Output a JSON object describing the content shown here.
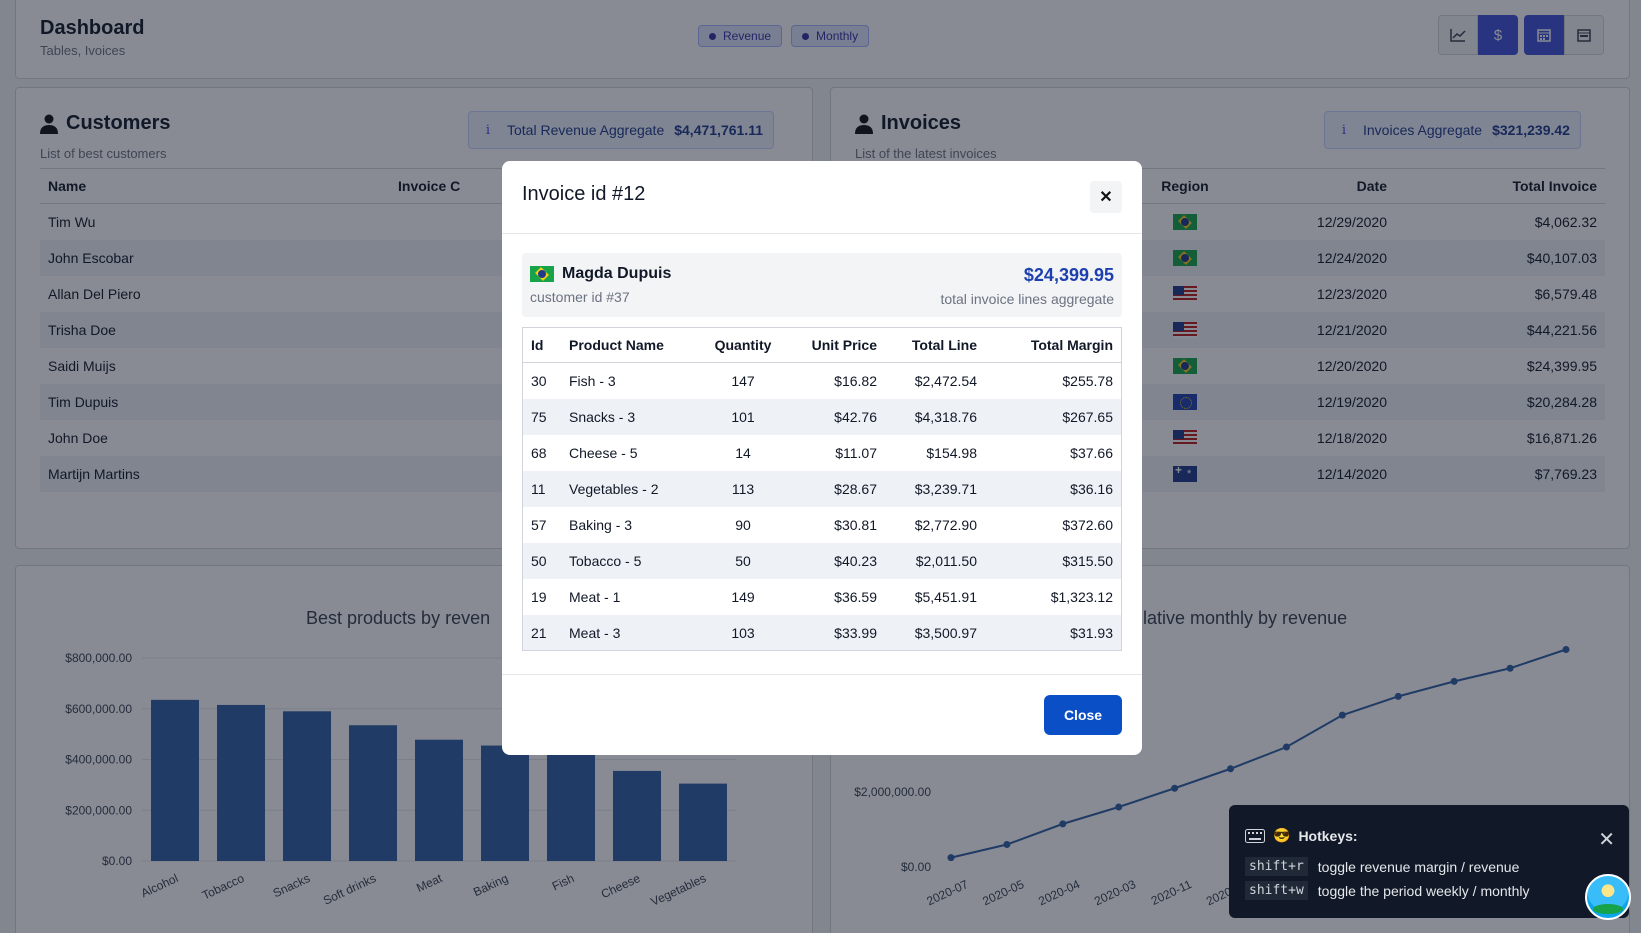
{
  "header": {
    "title": "Dashboard",
    "subtitle": "Tables, Ivoices",
    "pills": [
      "Revenue",
      "Monthly"
    ],
    "toolbar_icons": [
      "line-chart-icon",
      "dollar-icon",
      "calendar-month-icon",
      "calendar-week-icon"
    ]
  },
  "customers": {
    "title": "Customers",
    "subtitle": "List of best customers",
    "aggregate_label": "Total Revenue Aggregate",
    "aggregate_value": "$4,471,761.11",
    "columns": [
      "Name",
      "Invoice C"
    ],
    "rows": [
      "Tim Wu",
      "John Escobar",
      "Allan Del Piero",
      "Trisha Doe",
      "Saidi Muijs",
      "Tim Dupuis",
      "John Doe",
      "Martijn Martins"
    ]
  },
  "invoices": {
    "title": "Invoices",
    "subtitle": "List of the latest invoices",
    "aggregate_label": "Invoices Aggregate",
    "aggregate_value": "$321,239.42",
    "columns": [
      "Region",
      "Date",
      "Total Invoice"
    ],
    "rows": [
      {
        "region": "br",
        "date": "12/29/2020",
        "total": "$4,062.32"
      },
      {
        "region": "br",
        "date": "12/24/2020",
        "total": "$40,107.03"
      },
      {
        "region": "us",
        "date": "12/23/2020",
        "total": "$6,579.48"
      },
      {
        "region": "us",
        "date": "12/21/2020",
        "total": "$44,221.56"
      },
      {
        "region": "br",
        "date": "12/20/2020",
        "total": "$24,399.95"
      },
      {
        "region": "eu",
        "date": "12/19/2020",
        "total": "$20,284.28"
      },
      {
        "region": "us",
        "date": "12/18/2020",
        "total": "$16,871.26"
      },
      {
        "region": "au",
        "date": "12/14/2020",
        "total": "$7,769.23"
      }
    ]
  },
  "chart_data": [
    {
      "type": "bar",
      "title": "Best products by reven",
      "categories": [
        "Alcohol",
        "Tobacco",
        "Snacks",
        "Soft drinks",
        "Meat",
        "Baking",
        "Fish",
        "Cheese",
        "Vegetables"
      ],
      "values": [
        635000,
        615000,
        590000,
        535000,
        478000,
        455000,
        420000,
        355000,
        305000
      ],
      "ylim": [
        0,
        800000
      ],
      "yticks": [
        "$0.00",
        "$200,000.00",
        "$400,000.00",
        "$600,000.00",
        "$800,000.00"
      ],
      "color": "#2f5fa3"
    },
    {
      "type": "line",
      "title": "lative monthly by revenue",
      "x": [
        "2020-07",
        "2020-05",
        "2020-04",
        "2020-03",
        "2020-11",
        "2020-12",
        "",
        "",
        "",
        "",
        "",
        ""
      ],
      "values": [
        0.25,
        0.6,
        1.15,
        1.6,
        2.1,
        2.62,
        3.2,
        4.05,
        4.55,
        4.95,
        5.3,
        5.8
      ],
      "unit": "millions",
      "yticks": [
        "$0.00",
        "$2,000,000.00"
      ],
      "color": "#2f5fa3"
    }
  ],
  "modal": {
    "title": "Invoice id #12",
    "customer_name": "Magda Dupuis",
    "customer_id": "customer id #37",
    "amount": "$24,399.95",
    "amount_label": "total invoice lines aggregate",
    "columns": [
      "Id",
      "Product Name",
      "Quantity",
      "Unit Price",
      "Total Line",
      "Total Margin"
    ],
    "lines": [
      {
        "id": "30",
        "product": "Fish - 3",
        "qty": "147",
        "price": "$16.82",
        "total": "$2,472.54",
        "margin": "$255.78"
      },
      {
        "id": "75",
        "product": "Snacks - 3",
        "qty": "101",
        "price": "$42.76",
        "total": "$4,318.76",
        "margin": "$267.65"
      },
      {
        "id": "68",
        "product": "Cheese - 5",
        "qty": "14",
        "price": "$11.07",
        "total": "$154.98",
        "margin": "$37.66"
      },
      {
        "id": "11",
        "product": "Vegetables - 2",
        "qty": "113",
        "price": "$28.67",
        "total": "$3,239.71",
        "margin": "$36.16"
      },
      {
        "id": "57",
        "product": "Baking - 3",
        "qty": "90",
        "price": "$30.81",
        "total": "$2,772.90",
        "margin": "$372.60"
      },
      {
        "id": "50",
        "product": "Tobacco - 5",
        "qty": "50",
        "price": "$40.23",
        "total": "$2,011.50",
        "margin": "$315.50"
      },
      {
        "id": "19",
        "product": "Meat - 1",
        "qty": "149",
        "price": "$36.59",
        "total": "$5,451.91",
        "margin": "$1,323.12"
      },
      {
        "id": "21",
        "product": "Meat - 3",
        "qty": "103",
        "price": "$33.99",
        "total": "$3,500.97",
        "margin": "$31.93"
      }
    ],
    "close_label": "Close"
  },
  "hotkeys": {
    "title": "Hotkeys:",
    "items": [
      {
        "key": "shift+r",
        "desc": "toggle revenue margin / revenue"
      },
      {
        "key": "shift+w",
        "desc": "toggle the period weekly / monthly"
      }
    ]
  }
}
